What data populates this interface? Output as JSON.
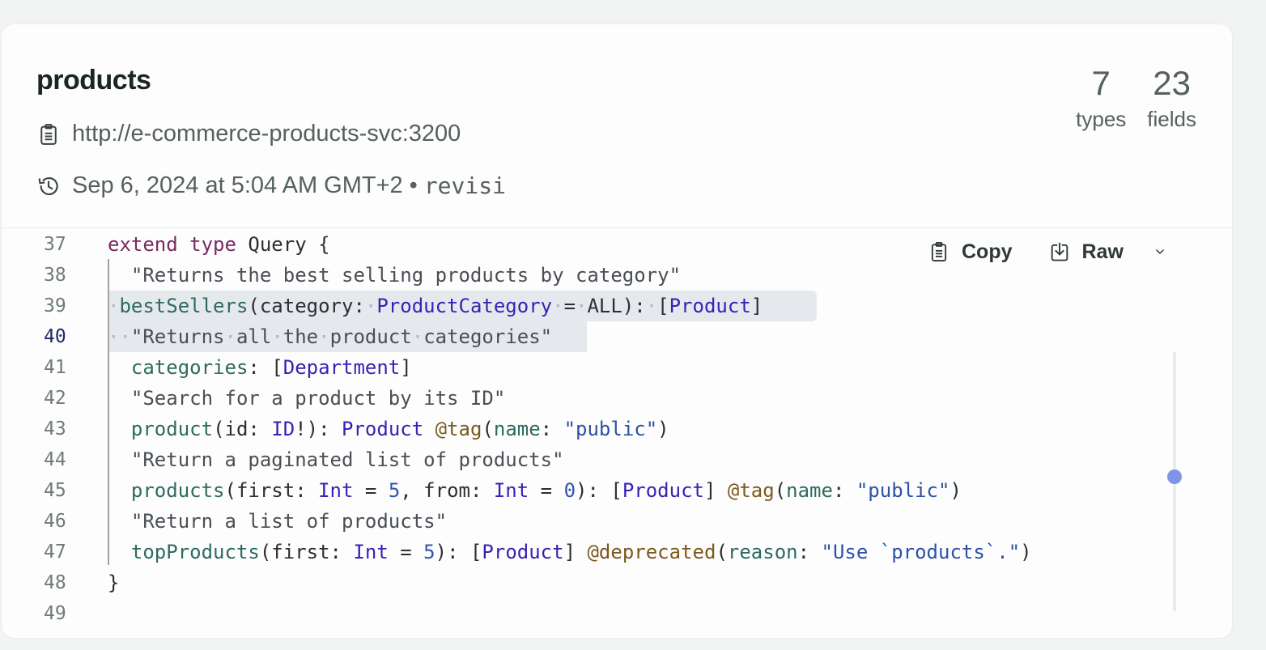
{
  "header": {
    "title": "products",
    "url": "http://e-commerce-products-svc:3200",
    "date": "Sep 6, 2024 at 5:04 AM GMT+2",
    "separator": "•",
    "revision": "revisi",
    "stats": [
      {
        "value": "7",
        "label": "types"
      },
      {
        "value": "23",
        "label": "fields"
      }
    ]
  },
  "actions": {
    "copy_label": "Copy",
    "raw_label": "Raw"
  },
  "scrollbar": {
    "position_fraction": 0.48
  },
  "code": {
    "active_line": 40,
    "lines": [
      {
        "n": "37",
        "tokens": [
          [
            "kw",
            "extend"
          ],
          [
            "pun",
            " "
          ],
          [
            "kw",
            "type"
          ],
          [
            "pun",
            " Query {"
          ]
        ]
      },
      {
        "n": "38",
        "tokens": [
          [
            "pun",
            "  "
          ],
          [
            "str",
            "\"Returns the best selling products by category\""
          ]
        ]
      },
      {
        "n": "39",
        "tokens": [
          [
            "ws",
            "·"
          ],
          [
            "fld",
            "bestSellers"
          ],
          [
            "pun",
            "(category:"
          ],
          [
            "ws",
            "·"
          ],
          [
            "typ",
            "ProductCategory"
          ],
          [
            "ws",
            "·"
          ],
          [
            "pun",
            "="
          ],
          [
            "ws",
            "·"
          ],
          [
            "pun",
            "ALL):"
          ],
          [
            "ws",
            "·"
          ],
          [
            "pun",
            "["
          ],
          [
            "typ",
            "Product"
          ],
          [
            "pun",
            "]"
          ]
        ]
      },
      {
        "n": "40",
        "tokens": [
          [
            "ws",
            "··"
          ],
          [
            "str",
            "\"Returns"
          ],
          [
            "ws",
            "·"
          ],
          [
            "str",
            "all"
          ],
          [
            "ws",
            "·"
          ],
          [
            "str",
            "the"
          ],
          [
            "ws",
            "·"
          ],
          [
            "str",
            "product"
          ],
          [
            "ws",
            "·"
          ],
          [
            "str",
            "categories\""
          ]
        ]
      },
      {
        "n": "41",
        "tokens": [
          [
            "pun",
            "  "
          ],
          [
            "fld",
            "categories"
          ],
          [
            "pun",
            ": ["
          ],
          [
            "typ",
            "Department"
          ],
          [
            "pun",
            "]"
          ]
        ]
      },
      {
        "n": "42",
        "tokens": [
          [
            "pun",
            "  "
          ],
          [
            "str",
            "\"Search for a product by its ID\""
          ]
        ]
      },
      {
        "n": "43",
        "tokens": [
          [
            "pun",
            "  "
          ],
          [
            "fld",
            "product"
          ],
          [
            "pun",
            "(id: "
          ],
          [
            "typ",
            "ID"
          ],
          [
            "pun",
            "!): "
          ],
          [
            "typ",
            "Product"
          ],
          [
            "pun",
            " "
          ],
          [
            "dir",
            "@tag"
          ],
          [
            "pun",
            "("
          ],
          [
            "fld",
            "name"
          ],
          [
            "pun",
            ": "
          ],
          [
            "sv",
            "\"public\""
          ],
          [
            "pun",
            ")"
          ]
        ]
      },
      {
        "n": "44",
        "tokens": [
          [
            "pun",
            "  "
          ],
          [
            "str",
            "\"Return a paginated list of products\""
          ]
        ]
      },
      {
        "n": "45",
        "tokens": [
          [
            "pun",
            "  "
          ],
          [
            "fld",
            "products"
          ],
          [
            "pun",
            "(first: "
          ],
          [
            "typ",
            "Int"
          ],
          [
            "pun",
            " = "
          ],
          [
            "num",
            "5"
          ],
          [
            "pun",
            ", from: "
          ],
          [
            "typ",
            "Int"
          ],
          [
            "pun",
            " = "
          ],
          [
            "num",
            "0"
          ],
          [
            "pun",
            "): ["
          ],
          [
            "typ",
            "Product"
          ],
          [
            "pun",
            "] "
          ],
          [
            "dir",
            "@tag"
          ],
          [
            "pun",
            "("
          ],
          [
            "fld",
            "name"
          ],
          [
            "pun",
            ": "
          ],
          [
            "sv",
            "\"public\""
          ],
          [
            "pun",
            ")"
          ]
        ]
      },
      {
        "n": "46",
        "tokens": [
          [
            "pun",
            "  "
          ],
          [
            "str",
            "\"Return a list of products\""
          ]
        ]
      },
      {
        "n": "47",
        "tokens": [
          [
            "pun",
            "  "
          ],
          [
            "fld",
            "topProducts"
          ],
          [
            "pun",
            "(first: "
          ],
          [
            "typ",
            "Int"
          ],
          [
            "pun",
            " = "
          ],
          [
            "num",
            "5"
          ],
          [
            "pun",
            "): ["
          ],
          [
            "typ",
            "Product"
          ],
          [
            "pun",
            "] "
          ],
          [
            "dir",
            "@deprecated"
          ],
          [
            "pun",
            "("
          ],
          [
            "fld",
            "reason"
          ],
          [
            "pun",
            ": "
          ],
          [
            "sv",
            "\"Use `products`.\""
          ],
          [
            "pun",
            ")"
          ]
        ]
      },
      {
        "n": "48",
        "tokens": [
          [
            "pun",
            "}"
          ]
        ]
      },
      {
        "n": "49",
        "tokens": []
      }
    ]
  }
}
